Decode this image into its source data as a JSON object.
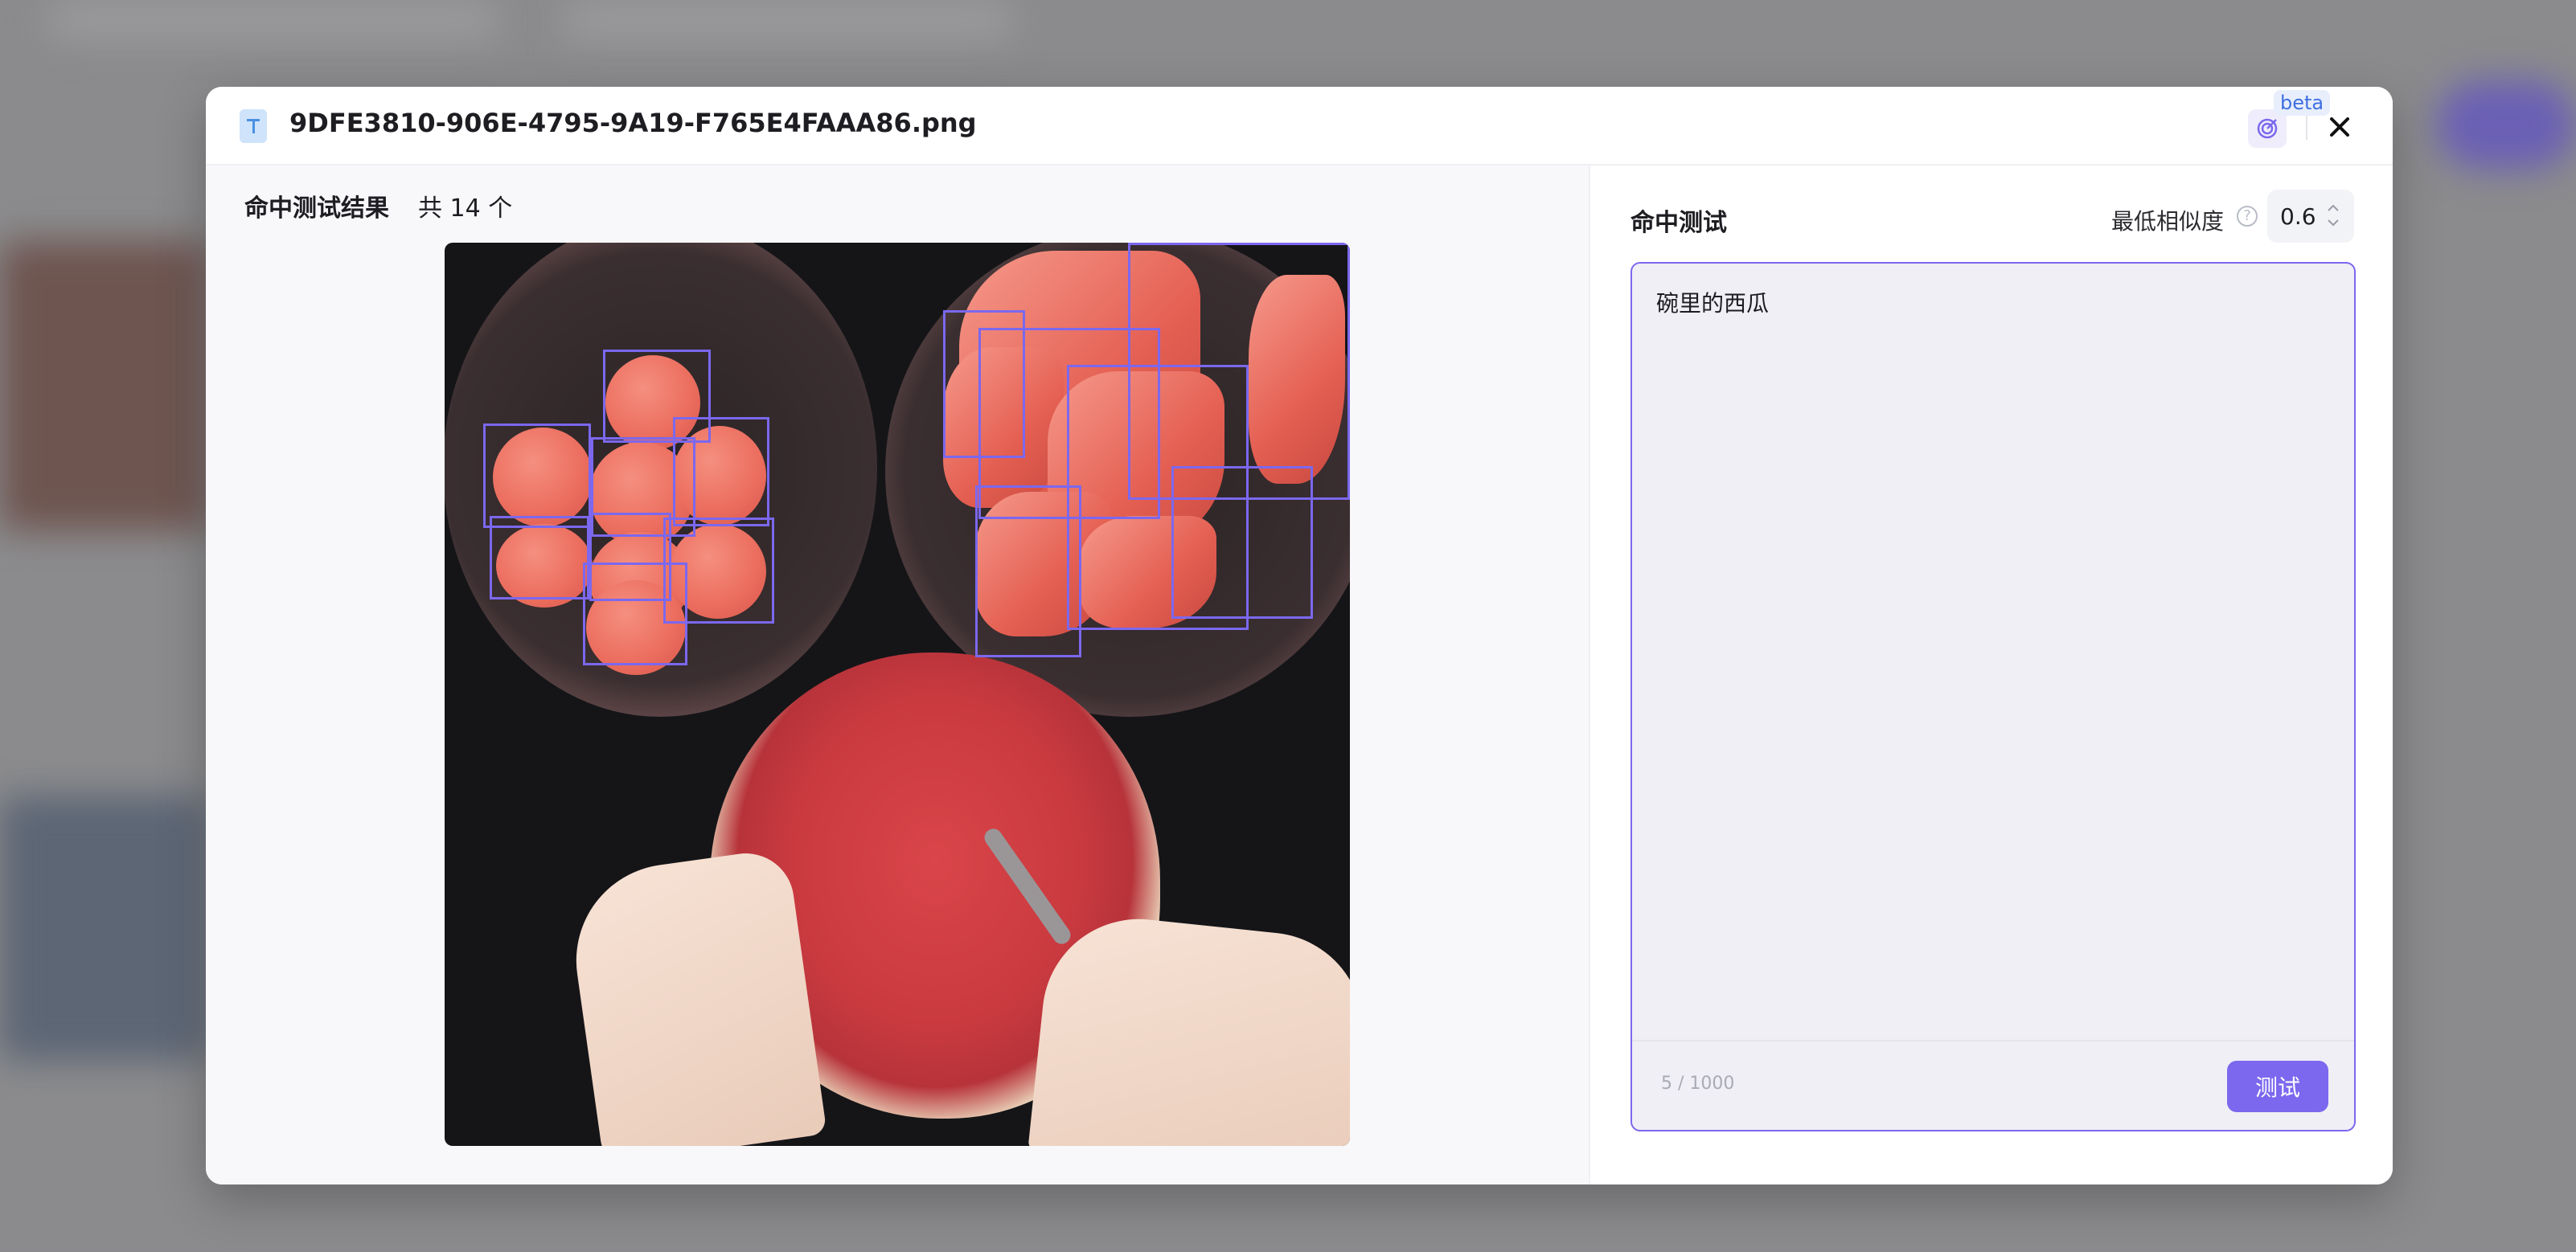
{
  "modal": {
    "file_name": "9DFE3810-906E-4795-9A19-F765E4FAAA86.png",
    "beta_label": "beta",
    "close_icon": "close-icon",
    "target_icon": "target-icon"
  },
  "results": {
    "title": "命中测试结果",
    "count_text": "共 14 个"
  },
  "test_panel": {
    "title": "命中测试",
    "similarity_label": "最低相似度",
    "similarity_value": "0.6",
    "query_text": "碗里的西瓜",
    "char_count": "5 / 1000",
    "test_button_label": "测试"
  },
  "colors": {
    "accent": "#7b68ee",
    "box_stroke": "#7b68ee"
  }
}
